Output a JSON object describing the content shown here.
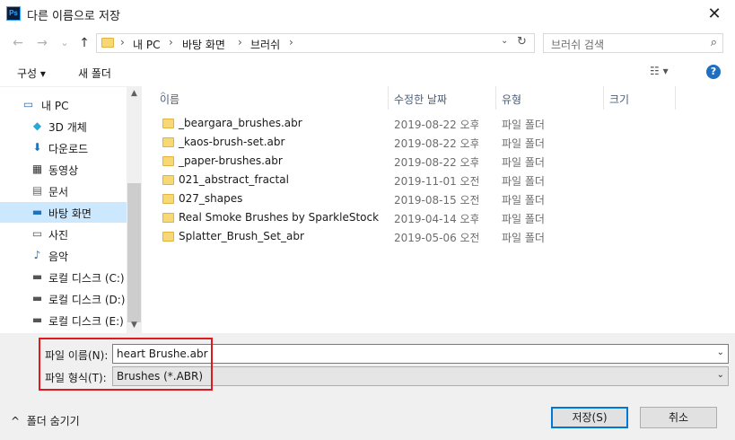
{
  "window": {
    "app_icon": "Ps",
    "title": "다른 이름으로 저장",
    "close": "✕"
  },
  "nav": {
    "back": "←",
    "forward": "→",
    "recent": "⌄",
    "up": "↑",
    "breadcrumb": [
      "내 PC",
      "바탕 화면",
      "브러쉬"
    ],
    "search_placeholder": "브러쉬 검색"
  },
  "toolbar": {
    "organize": "구성 ▾",
    "new_folder": "새 폴더",
    "help": "?"
  },
  "sidebar": {
    "items": [
      {
        "label": "내 PC",
        "icon": "pc-icon",
        "selected": false
      },
      {
        "label": "3D 개체",
        "icon": "3d-objects-icon",
        "selected": false
      },
      {
        "label": "다운로드",
        "icon": "download-icon",
        "selected": false
      },
      {
        "label": "동영상",
        "icon": "video-icon",
        "selected": false
      },
      {
        "label": "문서",
        "icon": "document-icon",
        "selected": false
      },
      {
        "label": "바탕 화면",
        "icon": "desktop-icon",
        "selected": true
      },
      {
        "label": "사진",
        "icon": "pictures-icon",
        "selected": false
      },
      {
        "label": "음악",
        "icon": "music-icon",
        "selected": false
      },
      {
        "label": "로컬 디스크 (C:)",
        "icon": "drive-c-icon",
        "selected": false
      },
      {
        "label": "로컬 디스크 (D:)",
        "icon": "drive-icon",
        "selected": false
      },
      {
        "label": "로컬 디스크 (E:)",
        "icon": "drive-icon",
        "selected": false
      }
    ]
  },
  "files": {
    "columns": [
      "이름",
      "수정한 날짜",
      "유형",
      "크기"
    ],
    "rows": [
      {
        "name": "_beargara_brushes.abr",
        "date": "2019-08-22 오후...",
        "type": "파일 폴더"
      },
      {
        "name": "_kaos-brush-set.abr",
        "date": "2019-08-22 오후...",
        "type": "파일 폴더"
      },
      {
        "name": "_paper-brushes.abr",
        "date": "2019-08-22 오후...",
        "type": "파일 폴더"
      },
      {
        "name": "021_abstract_fractal",
        "date": "2019-11-01 오전...",
        "type": "파일 폴더"
      },
      {
        "name": "027_shapes",
        "date": "2019-08-15 오전...",
        "type": "파일 폴더"
      },
      {
        "name": "Real Smoke Brushes by SparkleStock",
        "date": "2019-04-14 오후...",
        "type": "파일 폴더"
      },
      {
        "name": "Splatter_Brush_Set_abr",
        "date": "2019-05-06 오전...",
        "type": "파일 폴더"
      }
    ]
  },
  "form": {
    "filename_label": "파일 이름(N):",
    "filename_value": "heart Brushe.abr",
    "filetype_label": "파일 형식(T):",
    "filetype_value": "Brushes (*.ABR)",
    "hide_folders": "폴더 숨기기",
    "save": "저장(S)",
    "cancel": "취소"
  },
  "colors": {
    "selection": "#cce8ff",
    "highlight_border": "#e0191f",
    "primary_button_border": "#0078d7"
  }
}
